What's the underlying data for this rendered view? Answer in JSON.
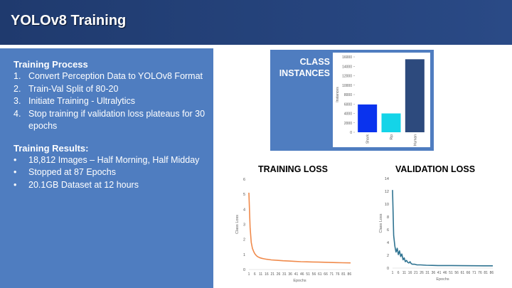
{
  "slide": {
    "title": "YOLOv8 Training"
  },
  "process": {
    "heading": "Training Process",
    "items": [
      {
        "marker": "1.",
        "text": "Convert Perception Data to YOLOv8 Format"
      },
      {
        "marker": "2.",
        "text": "Train-Val Split of 80-20"
      },
      {
        "marker": "3.",
        "text": "Initiate Training - Ultralytics"
      },
      {
        "marker": "4.",
        "text": "Stop training if validation loss plateaus for 30 epochs"
      }
    ]
  },
  "results": {
    "heading": "Training Results:",
    "items": [
      {
        "marker": "•",
        "text": "18,812 Images – Half Morning, Half Midday"
      },
      {
        "marker": "•",
        "text": "Stopped at 87 Epochs"
      },
      {
        "marker": "•",
        "text": "20.1GB Dataset at 12 hours"
      }
    ]
  },
  "chart_data": [
    {
      "type": "bar",
      "title": "CLASS INSTANCES",
      "ylabel": "Instances",
      "categories": [
        "Shark",
        "Rip",
        "Human"
      ],
      "values": [
        5900,
        4000,
        15500
      ],
      "colors": [
        "#0a33ee",
        "#14d4e8",
        "#2d4a7d"
      ],
      "ylim": [
        0,
        16000
      ],
      "yticks": [
        0,
        2000,
        4000,
        6000,
        8000,
        10000,
        12000,
        14000,
        16000
      ]
    },
    {
      "type": "line",
      "title": "TRAINING LOSS",
      "xlabel": "Epochs",
      "ylabel": "Class Loss",
      "color": "#f08a4b",
      "ylim": [
        0,
        6
      ],
      "yticks": [
        0,
        1,
        2,
        3,
        4,
        5,
        6
      ],
      "xticks": [
        1,
        6,
        11,
        16,
        21,
        26,
        31,
        36,
        41,
        46,
        51,
        56,
        61,
        66,
        71,
        76,
        81,
        86
      ],
      "x": [
        1,
        2,
        3,
        4,
        5,
        6,
        7,
        8,
        9,
        10,
        12,
        14,
        16,
        18,
        20,
        25,
        30,
        35,
        40,
        45,
        50,
        55,
        60,
        65,
        70,
        75,
        80,
        87
      ],
      "y": [
        5.1,
        2.8,
        1.8,
        1.4,
        1.2,
        1.05,
        0.95,
        0.88,
        0.83,
        0.79,
        0.74,
        0.71,
        0.68,
        0.66,
        0.64,
        0.61,
        0.58,
        0.56,
        0.54,
        0.52,
        0.51,
        0.5,
        0.49,
        0.48,
        0.47,
        0.46,
        0.45,
        0.44
      ]
    },
    {
      "type": "line",
      "title": "VALIDATION LOSS",
      "xlabel": "Epochs",
      "ylabel": "Class Loss",
      "color": "#2f7391",
      "ylim": [
        0,
        14
      ],
      "yticks": [
        0,
        2,
        4,
        6,
        8,
        10,
        12,
        14
      ],
      "xticks": [
        1,
        6,
        11,
        16,
        21,
        26,
        31,
        36,
        41,
        46,
        51,
        56,
        61,
        66,
        71,
        76,
        81,
        86
      ],
      "x": [
        1,
        2,
        3,
        4,
        5,
        6,
        7,
        8,
        9,
        10,
        11,
        12,
        13,
        14,
        15,
        16,
        17,
        18,
        20,
        22,
        25,
        30,
        35,
        40,
        50,
        60,
        70,
        80,
        87
      ],
      "y": [
        12.2,
        5.1,
        3.4,
        2.5,
        3.1,
        2.1,
        2.7,
        1.8,
        2.2,
        1.3,
        1.6,
        1.0,
        1.2,
        0.9,
        0.8,
        1.0,
        0.7,
        0.6,
        0.6,
        0.5,
        0.5,
        0.45,
        0.42,
        0.4,
        0.4,
        0.38,
        0.37,
        0.36,
        0.35
      ]
    }
  ]
}
